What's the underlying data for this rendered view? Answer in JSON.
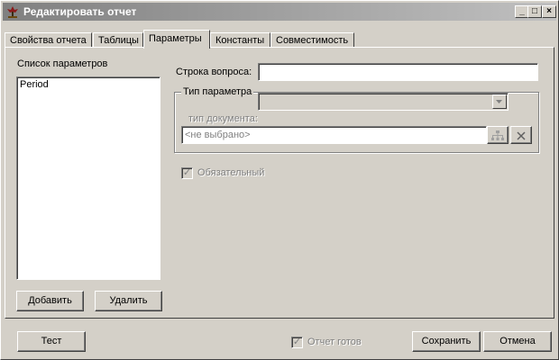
{
  "window": {
    "title": "Редактировать отчет",
    "minimize_glyph": "_",
    "maximize_glyph": "□",
    "close_glyph": "×"
  },
  "tabs": [
    {
      "label": "Свойства отчета",
      "active": false
    },
    {
      "label": "Таблицы",
      "active": false
    },
    {
      "label": "Параметры",
      "active": true
    },
    {
      "label": "Константы",
      "active": false
    },
    {
      "label": "Совместимость",
      "active": false
    }
  ],
  "params_panel": {
    "list_label": "Список параметров",
    "items": [
      "Period"
    ],
    "add_label": "Добавить",
    "delete_label": "Удалить"
  },
  "details": {
    "question_label": "Строка вопроса:",
    "question_value": "",
    "param_type_label": "Тип параметра",
    "param_type_value": "",
    "doc_type_label": "тип документа:",
    "doc_type_value": "<не выбрано>",
    "required_label": "Обязательный",
    "required_checked": true
  },
  "footer": {
    "test_label": "Тест",
    "ready_label": "Отчет готов",
    "ready_checked": true,
    "save_label": "Сохранить",
    "cancel_label": "Отмена"
  }
}
